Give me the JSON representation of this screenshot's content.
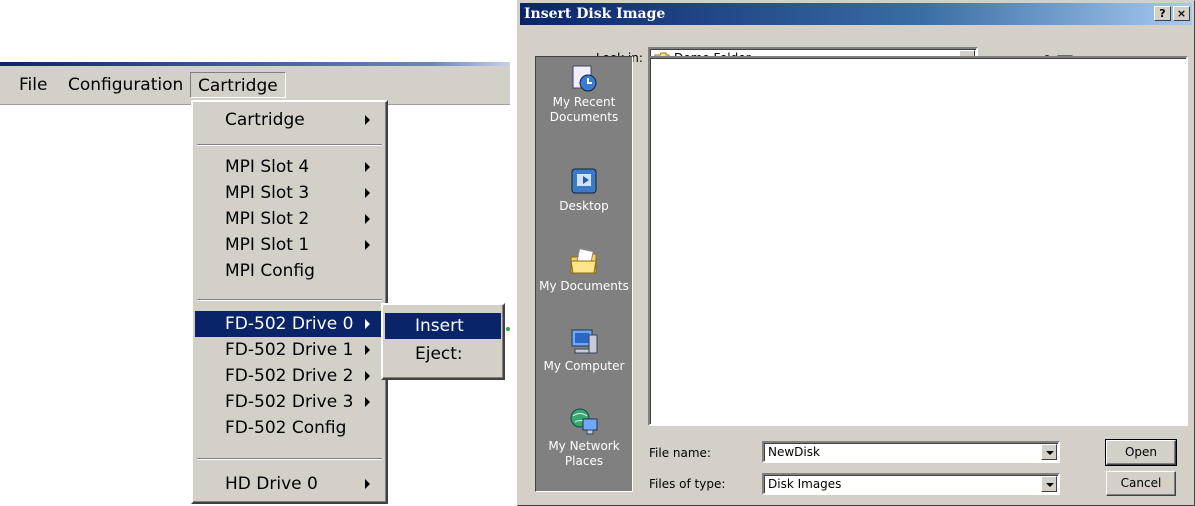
{
  "menubar": {
    "items": [
      "File",
      "Configuration",
      "Cartridge"
    ]
  },
  "cartridge_menu": {
    "items": [
      {
        "label": "Cartridge",
        "submenu": true
      },
      {
        "label": "MPI Slot 4",
        "submenu": true
      },
      {
        "label": "MPI Slot 3",
        "submenu": true
      },
      {
        "label": "MPI Slot 2",
        "submenu": true
      },
      {
        "label": "MPI Slot 1",
        "submenu": true
      },
      {
        "label": "MPI Config",
        "submenu": false
      },
      {
        "label": "FD-502 Drive 0",
        "submenu": true,
        "highlighted": true
      },
      {
        "label": "FD-502 Drive 1",
        "submenu": true
      },
      {
        "label": "FD-502 Drive 2",
        "submenu": true
      },
      {
        "label": "FD-502 Drive 3",
        "submenu": true
      },
      {
        "label": "FD-502 Config",
        "submenu": false
      },
      {
        "label": "HD Drive 0",
        "submenu": true
      }
    ]
  },
  "drive_submenu": {
    "items": [
      {
        "label": "Insert",
        "highlighted": true
      },
      {
        "label": "Eject:"
      }
    ]
  },
  "dialog": {
    "title": "Insert Disk Image",
    "help_button": "?",
    "close_button": "×",
    "look_in_label": "Look in:",
    "look_in_value": "Demo Folder",
    "places": [
      "My Recent Documents",
      "Desktop",
      "My Documents",
      "My Computer",
      "My Network Places"
    ],
    "file_name_label": "File name:",
    "file_name_value": "NewDisk",
    "files_of_type_label": "Files of type:",
    "files_of_type_value": "Disk Images",
    "open_button": "Open",
    "cancel_button": "Cancel"
  },
  "colors": {
    "menu_highlight": "#0a246a",
    "face": "#d4d0c8",
    "places_bar": "#808080"
  }
}
